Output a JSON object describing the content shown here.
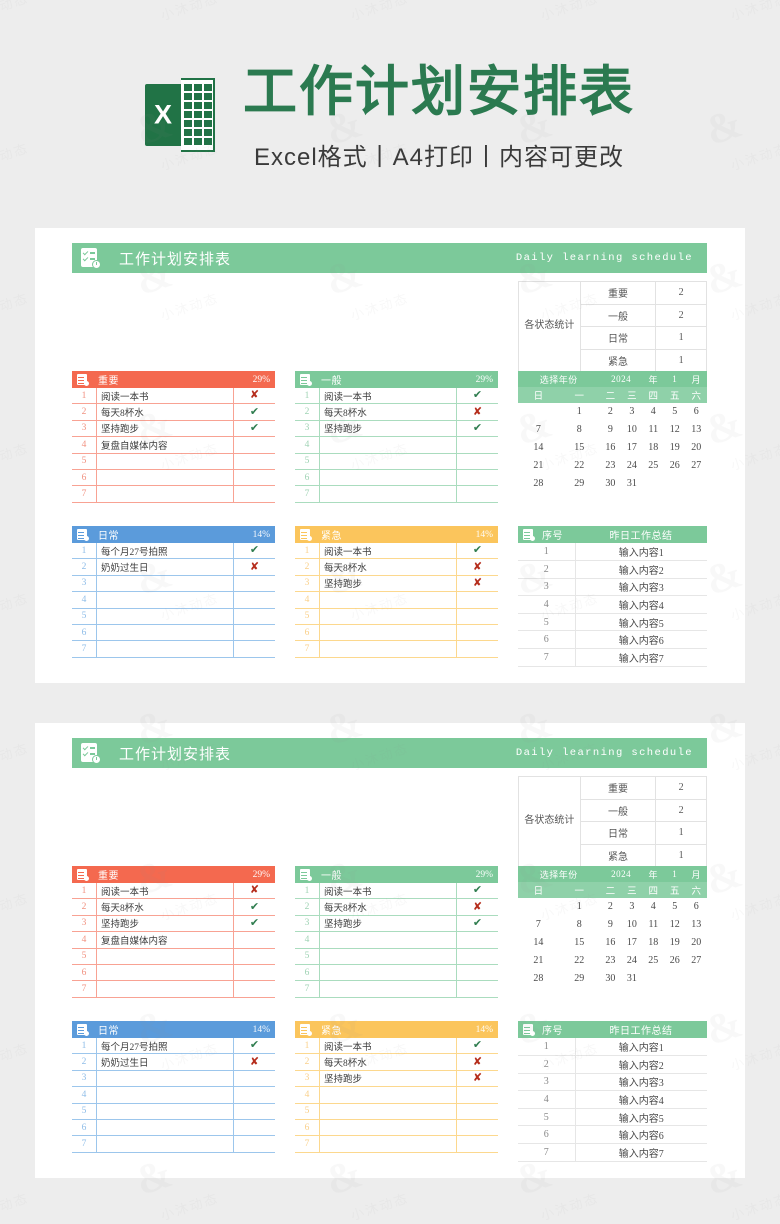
{
  "masthead": {
    "logo_letter": "X",
    "title": "工作计划安排表",
    "subtitle": "Excel格式丨A4打印丨内容可更改"
  },
  "watermark_text": "小沐动态",
  "panel": {
    "banner": {
      "icon": "checklist-clock-icon",
      "title": "工作计划安排表",
      "english": "Daily learning schedule",
      "color": "#7cc99a"
    },
    "stats": {
      "label": "各状态统计",
      "rows": [
        {
          "name": "重要",
          "count": "2"
        },
        {
          "name": "一般",
          "count": "2"
        },
        {
          "name": "日常",
          "count": "1"
        },
        {
          "name": "紧急",
          "count": "1"
        }
      ]
    },
    "cards": [
      {
        "key": "important",
        "title": "重要",
        "percent": "29%",
        "color": "#f4694f",
        "rows": [
          {
            "no": "1",
            "task": "阅读一本书",
            "mark": "✘",
            "state": "no"
          },
          {
            "no": "2",
            "task": "每天8杯水",
            "mark": "✔",
            "state": "yes"
          },
          {
            "no": "3",
            "task": "坚持跑步",
            "mark": "✔",
            "state": "yes"
          },
          {
            "no": "4",
            "task": "复盘自媒体内容",
            "mark": "",
            "state": ""
          },
          {
            "no": "5",
            "task": "",
            "mark": "",
            "state": ""
          },
          {
            "no": "6",
            "task": "",
            "mark": "",
            "state": ""
          },
          {
            "no": "7",
            "task": "",
            "mark": "",
            "state": ""
          }
        ]
      },
      {
        "key": "normal",
        "title": "一般",
        "percent": "29%",
        "color": "#7cc99a",
        "rows": [
          {
            "no": "1",
            "task": "阅读一本书",
            "mark": "✔",
            "state": "yes"
          },
          {
            "no": "2",
            "task": "每天8杯水",
            "mark": "✘",
            "state": "no"
          },
          {
            "no": "3",
            "task": "坚持跑步",
            "mark": "✔",
            "state": "yes"
          },
          {
            "no": "4",
            "task": "",
            "mark": "",
            "state": ""
          },
          {
            "no": "5",
            "task": "",
            "mark": "",
            "state": ""
          },
          {
            "no": "6",
            "task": "",
            "mark": "",
            "state": ""
          },
          {
            "no": "7",
            "task": "",
            "mark": "",
            "state": ""
          }
        ]
      },
      {
        "key": "daily",
        "title": "日常",
        "percent": "14%",
        "color": "#5b9bdb",
        "rows": [
          {
            "no": "1",
            "task": "每个月27号拍照",
            "mark": "✔",
            "state": "yes"
          },
          {
            "no": "2",
            "task": "奶奶过生日",
            "mark": "✘",
            "state": "no"
          },
          {
            "no": "3",
            "task": "",
            "mark": "",
            "state": ""
          },
          {
            "no": "4",
            "task": "",
            "mark": "",
            "state": ""
          },
          {
            "no": "5",
            "task": "",
            "mark": "",
            "state": ""
          },
          {
            "no": "6",
            "task": "",
            "mark": "",
            "state": ""
          },
          {
            "no": "7",
            "task": "",
            "mark": "",
            "state": ""
          }
        ]
      },
      {
        "key": "urgent",
        "title": "紧急",
        "percent": "14%",
        "color": "#fbc55c",
        "rows": [
          {
            "no": "1",
            "task": "阅读一本书",
            "mark": "✔",
            "state": "yes"
          },
          {
            "no": "2",
            "task": "每天8杯水",
            "mark": "✘",
            "state": "no"
          },
          {
            "no": "3",
            "task": "坚持跑步",
            "mark": "✘",
            "state": "no"
          },
          {
            "no": "4",
            "task": "",
            "mark": "",
            "state": ""
          },
          {
            "no": "5",
            "task": "",
            "mark": "",
            "state": ""
          },
          {
            "no": "6",
            "task": "",
            "mark": "",
            "state": ""
          },
          {
            "no": "7",
            "task": "",
            "mark": "",
            "state": ""
          }
        ]
      }
    ],
    "calendar": {
      "control": [
        "选择年份",
        "2024",
        "年",
        "1",
        "月"
      ],
      "year": "2024",
      "month": "1",
      "weekdays": [
        "日",
        "一",
        "二",
        "三",
        "四",
        "五",
        "六"
      ],
      "weeks": [
        [
          "",
          "1",
          "2",
          "3",
          "4",
          "5",
          "6"
        ],
        [
          "7",
          "8",
          "9",
          "10",
          "11",
          "12",
          "13"
        ],
        [
          "14",
          "15",
          "16",
          "17",
          "18",
          "19",
          "20"
        ],
        [
          "21",
          "22",
          "23",
          "24",
          "25",
          "26",
          "27"
        ],
        [
          "28",
          "29",
          "30",
          "31",
          "",
          "",
          ""
        ]
      ]
    },
    "summary": {
      "header_no": "序号",
      "header_title": "昨日工作总结",
      "rows": [
        {
          "no": "1",
          "text": "输入内容1"
        },
        {
          "no": "2",
          "text": "输入内容2"
        },
        {
          "no": "3",
          "text": "输入内容3"
        },
        {
          "no": "4",
          "text": "输入内容4"
        },
        {
          "no": "5",
          "text": "输入内容5"
        },
        {
          "no": "6",
          "text": "输入内容6"
        },
        {
          "no": "7",
          "text": "输入内容7"
        }
      ]
    }
  }
}
